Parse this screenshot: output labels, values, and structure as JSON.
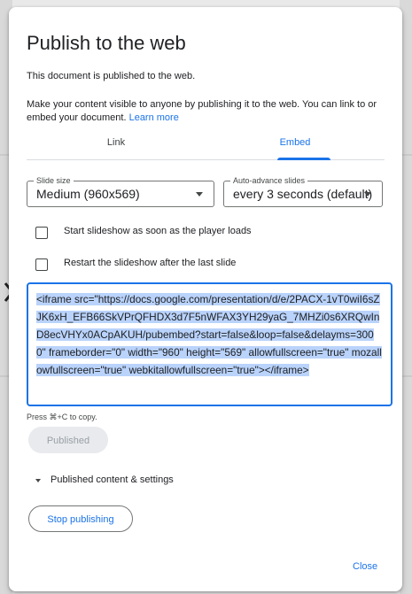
{
  "dialog": {
    "title": "Publish to the web",
    "status": "This document is published to the web.",
    "description": "Make your content visible to anyone by publishing it to the web. You can link to or embed your document. ",
    "learn_more": "Learn more"
  },
  "tabs": [
    {
      "label": "Link",
      "active": false
    },
    {
      "label": "Embed",
      "active": true
    }
  ],
  "slide_size": {
    "label": "Slide size",
    "value": "Medium (960x569)"
  },
  "auto_advance": {
    "label": "Auto-advance slides",
    "value": "every 3 seconds (default)"
  },
  "options": {
    "start_on_load": {
      "label": "Start slideshow as soon as the player loads",
      "checked": false
    },
    "restart_after_last": {
      "label": "Restart the slideshow after the last slide",
      "checked": false
    }
  },
  "embed_code": "<iframe src=\"https://docs.google.com/presentation/d/e/2PACX-1vT0wiI6sZJK6xH_EFB66SkVPrQFHDX3d7F5nWFAX3YH29yaG_7MHZi0s6XRQwInD8ecVHYx0ACpAKUH/pubembed?start=false&loop=false&delayms=3000\" frameborder=\"0\" width=\"960\" height=\"569\" allowfullscreen=\"true\" mozallowfullscreen=\"true\" webkitallowfullscreen=\"true\"></iframe>",
  "copy_hint": "Press ⌘+C to copy.",
  "buttons": {
    "published": "Published",
    "published_content": "Published content & settings",
    "stop_publishing": "Stop publishing",
    "close": "Close"
  },
  "colors": {
    "accent": "#1a73e8",
    "selection": "#b9d3fb"
  }
}
